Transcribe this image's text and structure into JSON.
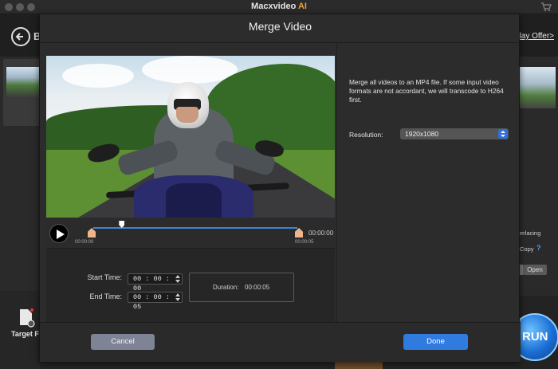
{
  "app": {
    "title_main": "Macxvideo",
    "title_ai": " AI"
  },
  "background": {
    "back_partial": "B",
    "offer_link": "iday Offer>",
    "target_label": "Target For",
    "right_labels": [
      "erlacing",
      "Copy",
      "?"
    ],
    "open_button": "Open",
    "run_button": "RUN"
  },
  "dialog": {
    "title": "Merge Video",
    "info_text": "Merge all videos to an MP4 file. If some input video formats are not accordant, we will transcode to H264 first.",
    "resolution_label": "Resolution:",
    "resolution_value": "1920x1080",
    "timeline": {
      "current_time": "00:00:00",
      "tick_start": "00:00:00",
      "tick_end": "00:00:05",
      "playhead_fraction": 0.14
    },
    "start_time_label": "Start Time:",
    "start_time_value": "00 : 00 : 00",
    "end_time_label": "End Time:",
    "end_time_value": "00 : 00 : 05",
    "duration_label": "Duration:",
    "duration_value": "00:00:05",
    "cancel_label": "Cancel",
    "done_label": "Done"
  },
  "colors": {
    "accent": "#2f7be0",
    "brand_ai": "#e8a33a",
    "trim_handle": "#f0b48a"
  }
}
